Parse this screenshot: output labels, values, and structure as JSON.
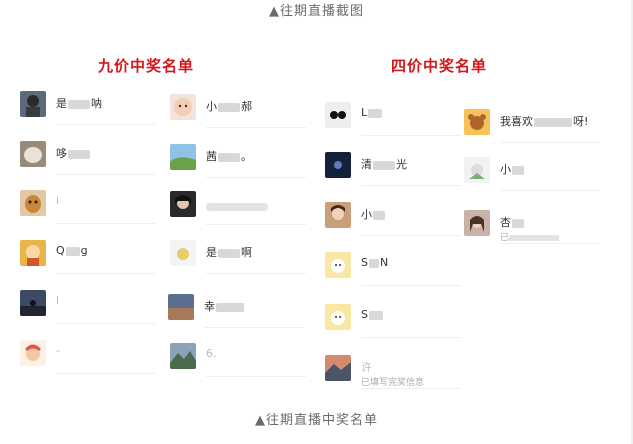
{
  "captions": {
    "top": "▲往期直播截图",
    "bottom": "▲往期直播中奖名单"
  },
  "columns": {
    "jiu": {
      "title": "九价中奖名单",
      "left": [
        {
          "pre": "是",
          "post": "呐"
        },
        {
          "pre": "",
          "post": "",
          "text": "哆"
        },
        {
          "pre": "",
          "post": "",
          "text": "i"
        },
        {
          "pre": "Q",
          "post": "g"
        },
        {
          "pre": "",
          "post": "",
          "text": "l"
        },
        {
          "pre": "",
          "post": "",
          "text": "-"
        }
      ],
      "right": [
        {
          "pre": "小",
          "post": "郝"
        },
        {
          "pre": "茜",
          "post": "。"
        },
        {
          "pre": "",
          "post": "",
          "text": ""
        },
        {
          "pre": "是",
          "post": "啊"
        },
        {
          "pre": "幸",
          "post": ""
        },
        {
          "pre": "",
          "post": "",
          "text": "6."
        }
      ]
    },
    "si": {
      "title": "四价中奖名单",
      "left": [
        {
          "pre": "L",
          "post": ""
        },
        {
          "pre": "清",
          "post": "光"
        },
        {
          "pre": "小",
          "post": ""
        },
        {
          "pre": "S",
          "post": "N"
        },
        {
          "pre": "S",
          "post": ""
        },
        {
          "pre": "",
          "post": "",
          "text": "许",
          "sub": "已填写完奖信息"
        }
      ],
      "right": [
        {
          "pre": "我喜欢",
          "post": "呀!"
        },
        {
          "pre": "小",
          "post": ""
        },
        {
          "pre": "杏",
          "post": "",
          "sub": "已"
        }
      ]
    }
  }
}
